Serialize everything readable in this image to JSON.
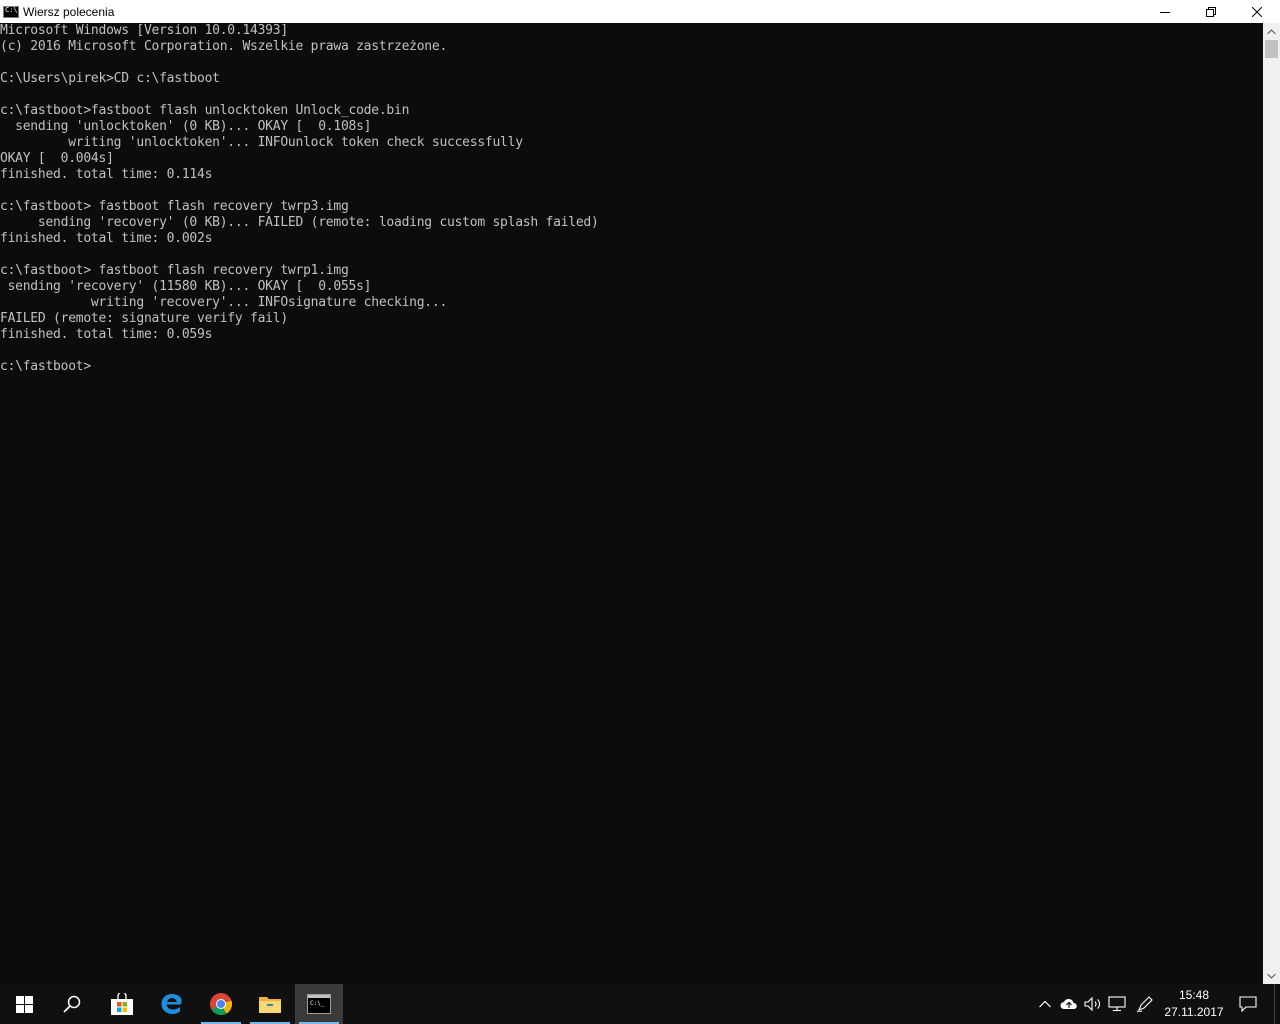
{
  "window": {
    "title": "Wiersz polecenia",
    "controls": [
      "minimize",
      "restore",
      "close"
    ]
  },
  "console": {
    "lines": [
      "Microsoft Windows [Version 10.0.14393]",
      "(c) 2016 Microsoft Corporation. Wszelkie prawa zastrzeżone.",
      "",
      "C:\\Users\\pirek>CD c:\\fastboot",
      "",
      "c:\\fastboot>fastboot flash unlocktoken Unlock_code.bin",
      "  sending 'unlocktoken' (0 KB)... OKAY [  0.108s]",
      "         writing 'unlocktoken'... INFOunlock token check successfully",
      "OKAY [  0.004s]",
      "finished. total time: 0.114s",
      "",
      "c:\\fastboot> fastboot flash recovery twrp3.img",
      "     sending 'recovery' (0 KB)... FAILED (remote: loading custom splash failed)",
      "finished. total time: 0.002s",
      "",
      "c:\\fastboot> fastboot flash recovery twrp1.img",
      " sending 'recovery' (11580 KB)... OKAY [  0.055s]",
      "            writing 'recovery'... INFOsignature checking...",
      "FAILED (remote: signature verify fail)",
      "finished. total time: 0.059s",
      "",
      "c:\\fastboot>"
    ]
  },
  "taskbar": {
    "pinned": [
      {
        "name": "start-button",
        "icon": "windows-logo-icon"
      },
      {
        "name": "search-button",
        "icon": "search-icon"
      },
      {
        "name": "store-button",
        "icon": "store-icon"
      },
      {
        "name": "edge-button",
        "icon": "edge-icon"
      },
      {
        "name": "chrome-button",
        "icon": "chrome-icon"
      },
      {
        "name": "file-explorer-button",
        "icon": "folder-icon"
      },
      {
        "name": "cmd-button",
        "icon": "cmd-icon",
        "active": true
      }
    ],
    "tray": [
      "chevron-up-icon",
      "cloud-upload-icon",
      "volume-icon",
      "network-icon",
      "pen-icon"
    ],
    "clock": {
      "time": "15:48",
      "date": "27.11.2017"
    }
  },
  "colors": {
    "console_bg": "#0c0c0c",
    "console_fg": "#c0c0c0",
    "taskbar_bg": "#101010",
    "accent": "#76b9ed"
  }
}
